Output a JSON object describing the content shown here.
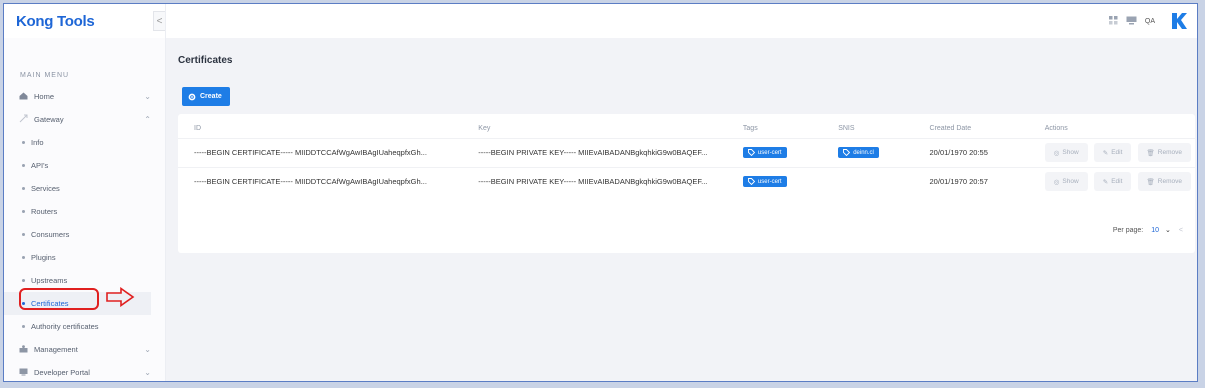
{
  "brand": {
    "logo_text": "Kong Tools"
  },
  "sidebar": {
    "collapse_glyph": "<",
    "menu_title": "MAIN MENU",
    "items": [
      {
        "label": "Home",
        "icon": "home-icon"
      },
      {
        "label": "Gateway",
        "icon": "gateway-icon"
      }
    ],
    "gateway_subitems": [
      "Info",
      "API's",
      "Services",
      "Routers",
      "Consumers",
      "Plugins",
      "Upstreams",
      "Certificates",
      "Authority certificates"
    ],
    "active_subitem": "Certificates",
    "bottom_items": [
      {
        "label": "Management",
        "icon": "management-icon"
      },
      {
        "label": "Developer Portal",
        "icon": "developer-portal-icon"
      }
    ]
  },
  "topbar": {
    "user_label": "QA",
    "icons": [
      "grid-icon",
      "monitor-icon",
      "kong-logo-icon"
    ]
  },
  "page": {
    "title": "Certificates",
    "create_label": "Create"
  },
  "table": {
    "columns": [
      "ID",
      "Key",
      "Tags",
      "SNIS",
      "Created Date",
      "Actions"
    ],
    "rows": [
      {
        "id": "-----BEGIN CERTIFICATE----- MIIDDTCCAfWgAwIBAgIUaheqpfxGh...",
        "key": "-----BEGIN PRIVATE KEY----- MIIEvAIBADANBgkqhkiG9w0BAQEF...",
        "tag": "user-cert",
        "sni": "deinn.cl",
        "created": "20/01/1970 20:55"
      },
      {
        "id": "-----BEGIN CERTIFICATE----- MIIDDTCCAfWgAwIBAgIUaheqpfxGh...",
        "key": "-----BEGIN PRIVATE KEY----- MIIEvAIBADANBgkqhkiG9w0BAQEF...",
        "tag": "user-cert",
        "sni": "",
        "created": "20/01/1970 20:57"
      }
    ],
    "actions": {
      "show": "Show",
      "edit": "Edit",
      "remove": "Remove"
    }
  },
  "pagination": {
    "per_page_label": "Per page:",
    "per_page_value": "10",
    "prev_glyph": "<"
  },
  "colors": {
    "accent": "#1e7de6",
    "highlight": "#e02020"
  }
}
